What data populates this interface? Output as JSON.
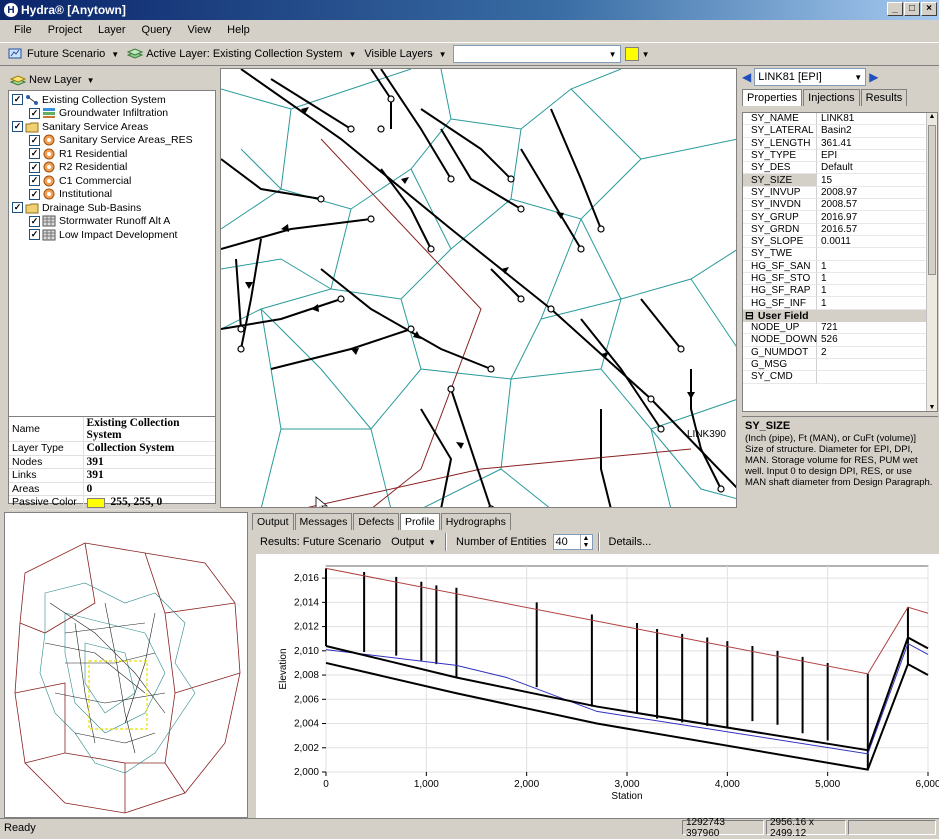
{
  "window": {
    "title": "Hydra® [Anytown]"
  },
  "menu": [
    "File",
    "Project",
    "Layer",
    "Query",
    "View",
    "Help"
  ],
  "toolbar": {
    "scenario": "Future Scenario",
    "active_layer": "Active Layer: Existing Collection System",
    "visible_layers": "Visible Layers",
    "swatch_color": "#ffff00"
  },
  "layers": {
    "new_layer_label": "New Layer",
    "items": [
      {
        "label": "Existing Collection System",
        "level": 0
      },
      {
        "label": "Groundwater Infiltration",
        "level": 1
      },
      {
        "label": "Sanitary Service Areas",
        "level": 0
      },
      {
        "label": "Sanitary Service Areas_RES",
        "level": 1
      },
      {
        "label": "R1 Residential",
        "level": 1
      },
      {
        "label": "R2 Residential",
        "level": 1
      },
      {
        "label": "C1 Commercial",
        "level": 1
      },
      {
        "label": "Institutional",
        "level": 1
      },
      {
        "label": "Drainage Sub-Basins",
        "level": 0
      },
      {
        "label": "Stormwater Runoff Alt A",
        "level": 1
      },
      {
        "label": "Low Impact Development",
        "level": 1
      }
    ]
  },
  "layer_props": {
    "rows": [
      {
        "k": "Name",
        "v": "Existing Collection System"
      },
      {
        "k": "Layer Type",
        "v": "Collection System"
      },
      {
        "k": "Nodes",
        "v": "391"
      },
      {
        "k": "Links",
        "v": "391"
      },
      {
        "k": "Areas",
        "v": "0"
      }
    ],
    "passive_color_label": "Passive Color",
    "passive_color_value": "255, 255, 0"
  },
  "map": {
    "link_label": "LINK390"
  },
  "right": {
    "link_selector": "LINK81 [EPI]",
    "tabs": [
      "Properties",
      "Injections",
      "Results"
    ],
    "props": [
      {
        "k": "SY_NAME",
        "v": "LINK81"
      },
      {
        "k": "SY_LATERAL",
        "v": "Basin2"
      },
      {
        "k": "SY_LENGTH",
        "v": "361.41"
      },
      {
        "k": "SY_TYPE",
        "v": "EPI"
      },
      {
        "k": "SY_DES",
        "v": "Default"
      },
      {
        "k": "SY_SIZE",
        "v": "15"
      },
      {
        "k": "SY_INVUP",
        "v": "2008.97"
      },
      {
        "k": "SY_INVDN",
        "v": "2008.57"
      },
      {
        "k": "SY_GRUP",
        "v": "2016.97"
      },
      {
        "k": "SY_GRDN",
        "v": "2016.57"
      },
      {
        "k": "SY_SLOPE",
        "v": "0.0011"
      },
      {
        "k": "SY_TWE",
        "v": ""
      },
      {
        "k": "HG_SF_SAN",
        "v": "1"
      },
      {
        "k": "HG_SF_STO",
        "v": "1"
      },
      {
        "k": "HG_SF_RAP",
        "v": "1"
      },
      {
        "k": "HG_SF_INF",
        "v": "1"
      }
    ],
    "user_field_label": "User Field",
    "user_props": [
      {
        "k": "NODE_UP",
        "v": "721"
      },
      {
        "k": "NODE_DOWN",
        "v": "526"
      },
      {
        "k": "G_NUMDOT",
        "v": "2"
      },
      {
        "k": "G_MSG",
        "v": ""
      },
      {
        "k": "SY_CMD",
        "v": ""
      }
    ],
    "desc_title": "SY_SIZE",
    "desc_text": "(Inch (pipe), Ft (MAN), or CuFt (volume)] Size of structure. Diameter for EPI, DPI, MAN. Storage volume for RES, PUM wet well. Input 0 to design DPI, RES, or use MAN shaft diameter from Design Paragraph."
  },
  "bottom": {
    "tabs": [
      "Output",
      "Messages",
      "Defects",
      "Profile",
      "Hydrographs"
    ],
    "results_label": "Results: Future Scenario",
    "output_label": "Output",
    "entities_label": "Number of Entities",
    "entities_value": "40",
    "details_label": "Details..."
  },
  "chart_data": {
    "type": "line",
    "xlabel": "Station",
    "ylabel": "Elevation",
    "xlim": [
      0,
      6000
    ],
    "ylim": [
      2000,
      2017
    ],
    "xticks": [
      "0",
      "1,000",
      "2,000",
      "3,000",
      "4,000",
      "5,000",
      "6,000"
    ],
    "yticks": [
      "2,000",
      "2,002",
      "2,004",
      "2,006",
      "2,008",
      "2,010",
      "2,012",
      "2,014",
      "2,016"
    ],
    "series": [
      {
        "color": "#b04040",
        "x": [
          0,
          5400,
          5400,
          5800,
          6000
        ],
        "y": [
          2016.8,
          2008.1,
          2008.1,
          2013.6,
          2013.1
        ]
      },
      {
        "color": "#3030c0",
        "x": [
          0,
          1300,
          1800,
          2700,
          5400,
          5800,
          6000
        ],
        "y": [
          2010.1,
          2008.8,
          2007.8,
          2005.0,
          2001.5,
          2010.6,
          2009.7
        ]
      },
      {
        "color": "#000000",
        "x": [
          0,
          1300,
          2700,
          5400,
          5800,
          6000
        ],
        "y": [
          2010.4,
          2007.8,
          2005.4,
          2001.8,
          2011.1,
          2010.2
        ]
      },
      {
        "color": "#000000",
        "x": [
          0,
          1300,
          2700,
          5400,
          5800,
          6000
        ],
        "y": [
          2009.0,
          2006.5,
          2004.0,
          2000.2,
          2008.9,
          2008.0
        ]
      }
    ],
    "verticals": [
      {
        "x": 0,
        "top": 2016.8,
        "bottom": 2010.4
      },
      {
        "x": 380,
        "top": 2016.5,
        "bottom": 2009.9
      },
      {
        "x": 700,
        "top": 2016.1,
        "bottom": 2009.6
      },
      {
        "x": 950,
        "top": 2015.7,
        "bottom": 2009.2
      },
      {
        "x": 1100,
        "top": 2015.4,
        "bottom": 2008.9
      },
      {
        "x": 1300,
        "top": 2015.2,
        "bottom": 2007.8
      },
      {
        "x": 2100,
        "top": 2014.0,
        "bottom": 2007.0
      },
      {
        "x": 2650,
        "top": 2013.0,
        "bottom": 2005.4
      },
      {
        "x": 3100,
        "top": 2012.3,
        "bottom": 2004.8
      },
      {
        "x": 3300,
        "top": 2011.8,
        "bottom": 2004.4
      },
      {
        "x": 3550,
        "top": 2011.4,
        "bottom": 2004.1
      },
      {
        "x": 3800,
        "top": 2011.1,
        "bottom": 2003.8
      },
      {
        "x": 4000,
        "top": 2010.8,
        "bottom": 2003.6
      },
      {
        "x": 4250,
        "top": 2010.4,
        "bottom": 2004.2
      },
      {
        "x": 4500,
        "top": 2010.0,
        "bottom": 2003.9
      },
      {
        "x": 4750,
        "top": 2009.5,
        "bottom": 2003.2
      },
      {
        "x": 5000,
        "top": 2009.0,
        "bottom": 2002.6
      },
      {
        "x": 5400,
        "top": 2008.1,
        "bottom": 2000.2
      },
      {
        "x": 5800,
        "top": 2013.6,
        "bottom": 2008.9
      }
    ]
  },
  "status": {
    "ready": "Ready",
    "coords": "1292743 397960",
    "size": "2956.16 x 2499.12"
  }
}
